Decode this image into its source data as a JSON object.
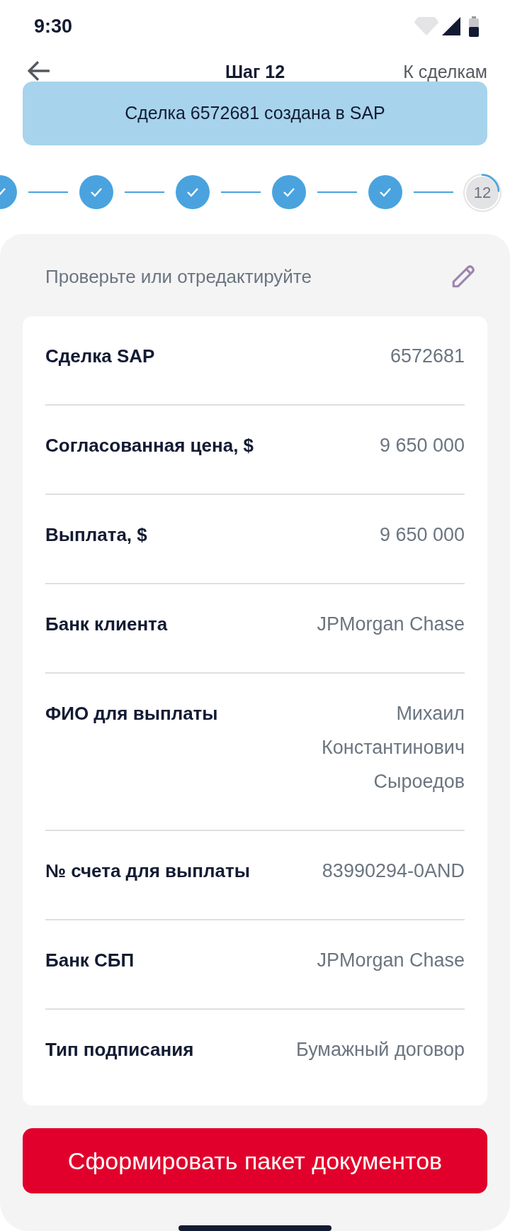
{
  "status_bar": {
    "time": "9:30"
  },
  "header": {
    "title": "Шаг 12",
    "link": "К сделкам"
  },
  "toast": {
    "text": "Сделка 6572681 создана в SAP"
  },
  "steps": [
    {
      "done": true
    },
    {
      "done": true
    },
    {
      "done": true
    },
    {
      "done": true
    },
    {
      "done": true
    },
    {
      "done": false,
      "label": "12"
    }
  ],
  "panel": {
    "title": "Проверьте или отредактируйте"
  },
  "fields": [
    {
      "label": "Сделка SAP",
      "value": "6572681"
    },
    {
      "label": "Согласованная цена, $",
      "value": "9 650 000"
    },
    {
      "label": "Выплата, $",
      "value": "9 650 000"
    },
    {
      "label": "Банк клиента",
      "value": "JPMorgan Chase"
    },
    {
      "label": "ФИО для выплаты",
      "value": "Михаил Константинович Сыроедов"
    },
    {
      "label": "№ счета для выплаты",
      "value": "83990294-0AND"
    },
    {
      "label": "Банк СБП",
      "value": "JPMorgan Chase"
    },
    {
      "label": "Тип подписания",
      "value": "Бумажный договор"
    }
  ],
  "button": {
    "label": "Сформировать пакет документов"
  }
}
